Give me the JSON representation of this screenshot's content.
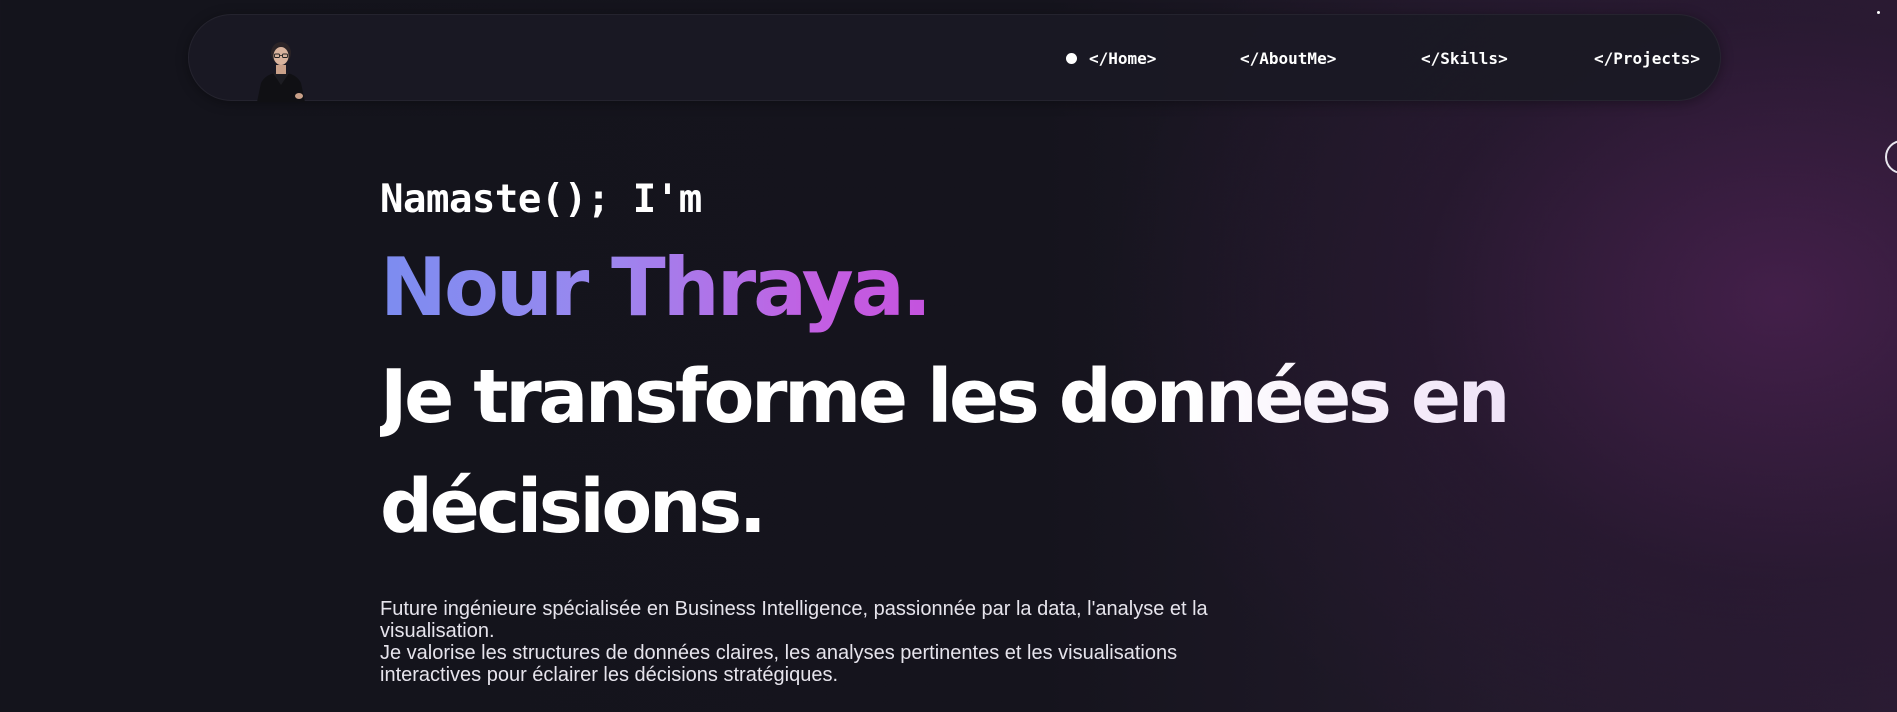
{
  "nav": {
    "avatar_alt": "Nour Thraya",
    "links": [
      {
        "label": "</Home>",
        "active": true
      },
      {
        "label": "</AboutMe>"
      },
      {
        "label": "</Skills>"
      },
      {
        "label": "</Projects>"
      }
    ]
  },
  "hero": {
    "greeting": "Namaste(); I'm",
    "name": "Nour Thraya.",
    "headline": "Je transforme les données en décisions.",
    "description": [
      "Future ingénieure spécialisée en Business Intelligence, passionnée par la data, l'analyse et la visualisation.",
      "Je valorise les structures de données claires, les analyses pertinentes et les visualisations interactives pour éclairer les décisions stratégiques."
    ]
  },
  "colors": {
    "background": "#14141c",
    "accent_start": "#7c8cf0",
    "accent_end": "#c453de",
    "text": "#ffffff"
  }
}
